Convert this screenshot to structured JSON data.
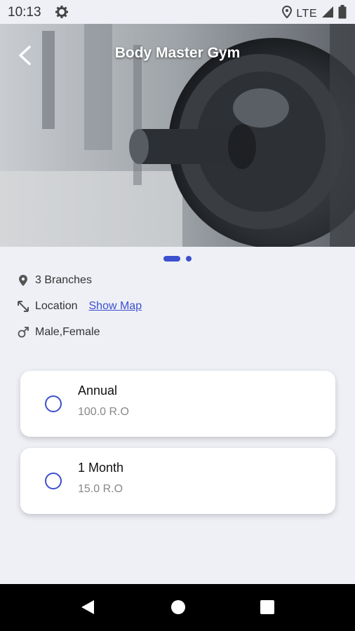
{
  "status_bar": {
    "time": "10:13",
    "network": "LTE"
  },
  "header": {
    "title": "Body Master Gym"
  },
  "carousel": {
    "page_count": 2,
    "active_index": 0
  },
  "info": {
    "branches": "3 Branches",
    "location_label": "Location",
    "show_map": "Show Map",
    "gender": "Male,Female"
  },
  "plans": [
    {
      "name": "Annual",
      "price": "100.0 R.O",
      "selected": false
    },
    {
      "name": "1 Month",
      "price": "15.0 R.O",
      "selected": false
    }
  ],
  "colors": {
    "accent": "#3b4fcf",
    "background": "#eef0f6"
  },
  "icons": [
    "gear-icon",
    "location-pin-icon",
    "signal-icon",
    "battery-icon",
    "back-arrow-icon",
    "direction-icon",
    "male-icon",
    "back-nav-icon",
    "home-nav-icon",
    "recents-nav-icon"
  ]
}
